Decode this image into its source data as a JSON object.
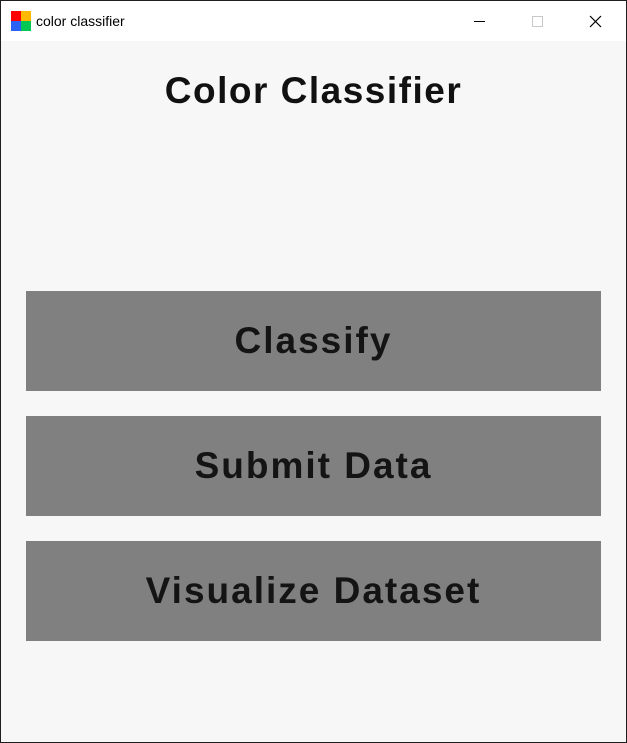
{
  "window": {
    "title": "color classifier",
    "icon": "four-color-squares-icon",
    "controls": {
      "minimize": "minimize-icon",
      "maximize": "maximize-icon",
      "close": "close-icon"
    }
  },
  "app_icon_colors": [
    "#ff0000",
    "#ffb900",
    "#2b62f6",
    "#00c853"
  ],
  "main": {
    "heading": "Color Classifier",
    "buttons": [
      {
        "label": "Classify"
      },
      {
        "label": "Submit Data"
      },
      {
        "label": "Visualize Dataset"
      }
    ]
  },
  "colors": {
    "background": "#f7f7f7",
    "button": "#808080",
    "text": "#111111"
  }
}
